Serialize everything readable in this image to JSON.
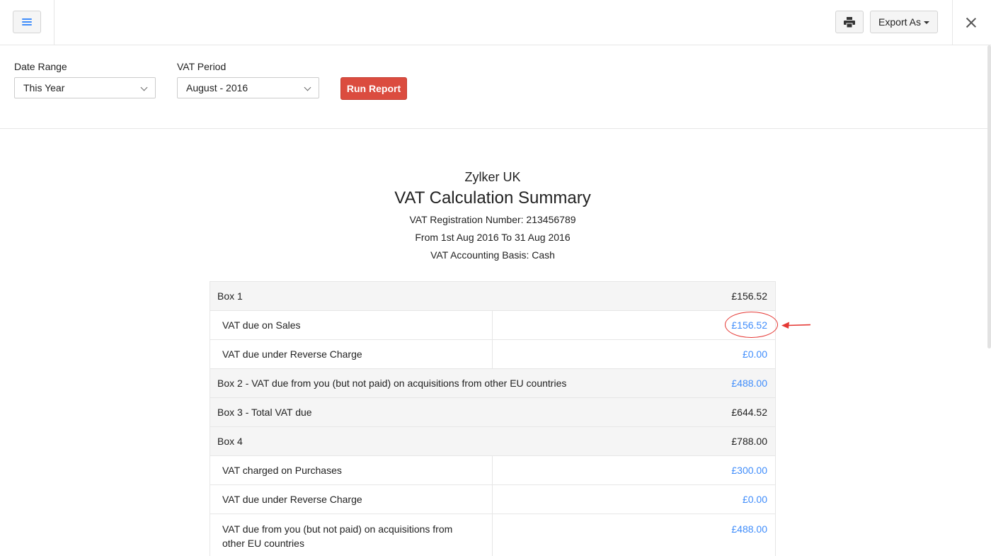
{
  "toolbar": {
    "export_label": "Export As"
  },
  "filters": {
    "date_range": {
      "label": "Date Range",
      "value": "This Year"
    },
    "vat_period": {
      "label": "VAT Period",
      "value": "August - 2016"
    },
    "run_label": "Run Report"
  },
  "report": {
    "org_name": "Zylker UK",
    "title": "VAT Calculation Summary",
    "registration": "VAT Registration Number: 213456789",
    "period": "From 1st Aug 2016 To 31 Aug 2016",
    "basis": "VAT Accounting Basis: Cash"
  },
  "rows": [
    {
      "label": "Box 1",
      "amount": "£156.52"
    },
    {
      "label": "VAT due on Sales",
      "amount": "£156.52"
    },
    {
      "label": "VAT due under Reverse Charge",
      "amount": "£0.00"
    },
    {
      "label": "Box 2 - VAT due from you (but not paid) on acquisitions from other EU countries",
      "amount": "£488.00"
    },
    {
      "label": "Box 3 - Total VAT due",
      "amount": "£644.52"
    },
    {
      "label": "Box 4",
      "amount": "£788.00"
    },
    {
      "label": "VAT charged on Purchases",
      "amount": "£300.00"
    },
    {
      "label": "VAT due under Reverse Charge",
      "amount": "£0.00"
    },
    {
      "label": "VAT due from you (but not paid) on acquisitions from other EU countries",
      "amount": "£488.00"
    }
  ],
  "colors": {
    "accent": "#408dfb",
    "run_button": "#db4c3f",
    "annotation": "#e53935"
  }
}
